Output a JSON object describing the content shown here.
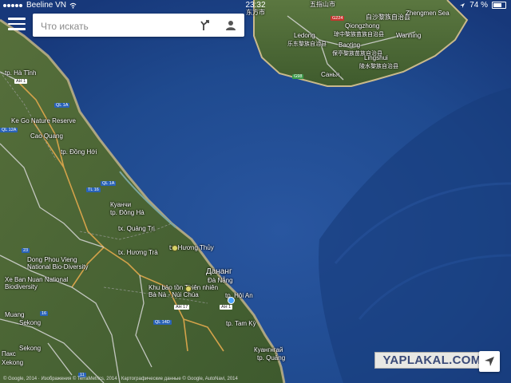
{
  "status_bar": {
    "carrier": "Beeline VN",
    "time": "23:32",
    "battery_text": "74 %",
    "icons": [
      "signal-dots-icon",
      "wifi-icon",
      "location-arrow-icon",
      "battery-icon"
    ]
  },
  "search": {
    "placeholder": "Что искать",
    "menu_icon": "hamburger-menu-icon",
    "directions_icon": "directions-icon",
    "account_icon": "account-icon"
  },
  "watermark": {
    "text": "YAPLAKAL.COM"
  },
  "copyright": "© Google, 2014 · Изображения © TerraMetrics, 2014 · Картографические данные © Google, AutoNavi, 2014",
  "places": {
    "qiongzhong": "Qiongzhong",
    "qiongzhong_zh": "琼中黎族苗族自治县",
    "ledong": "Ledong",
    "ledong_zh": "乐东黎族自治县",
    "baoting": "Baoting",
    "baoting_zh": "保亭黎族苗族自治县",
    "lingshui": "Lingshui",
    "lingshui_zh": "陵水黎族自治县",
    "zhengmen": "Zhengmen Sea",
    "sanya": "Санья",
    "wanning": "Wanning",
    "top_zh1": "东方市",
    "top_zh2": "白沙黎族自治县",
    "top_zh3": "五指山市",
    "ha_tinh": "tp. Hà Tĩnh",
    "ke_go": "Ke Go Nature Reserve",
    "cao_quang": "Cao Quang",
    "dong_hoi": "tp. Đồng Hới",
    "dong_ha_ru": "Куанчи",
    "dong_ha": "tp. Đông Hà",
    "quang_tri": "tx. Quảng Trị",
    "huong_tra": "tx. Hương Trà",
    "huong_thuy": "tx. Hương Thủy",
    "dong_phou": "Dong Phou Vieng National Bio-Diversity",
    "xe_ban": "Xe Ban Nuan National Biodiversity",
    "muang": "Muang",
    "danang_ru": "Дананг",
    "danang": "Đà Nẵng",
    "ba_na": "Khu bảo tồn Thiên nhiên Bà Nà - Núi Chúa",
    "hoi_an": "tp. Hội An",
    "tam_ky": "tp. Tam Kỳ",
    "quang_ngai_ru": "Куангнгай",
    "quang_ngai": "tp. Quảng",
    "pakse": "Пакс",
    "sekong": "Sekong",
    "sekong_region": "Sekong",
    "xekong": "Xekong"
  },
  "road_shields": {
    "ah1_north": "AH 1",
    "ql1a_north": "QL 1A",
    "ql12a": "QL 12A",
    "tl16": "TL 16",
    "ql1a_south": "QL 1A",
    "ah17": "AH 17",
    "ql14d": "QL 14D",
    "ah1_south": "AH 1",
    "g224": "G224",
    "g98": "G98",
    "r23": "23",
    "r16": "16",
    "r11": "11"
  },
  "colors": {
    "sea": "#1f4a8f",
    "sea_deep": "#163672",
    "land": "#4d6a38",
    "land_dark": "#38552a",
    "coast_sand": "#c9b98b",
    "road_orange": "#d3a24a",
    "road_white": "#d8d8d8"
  }
}
